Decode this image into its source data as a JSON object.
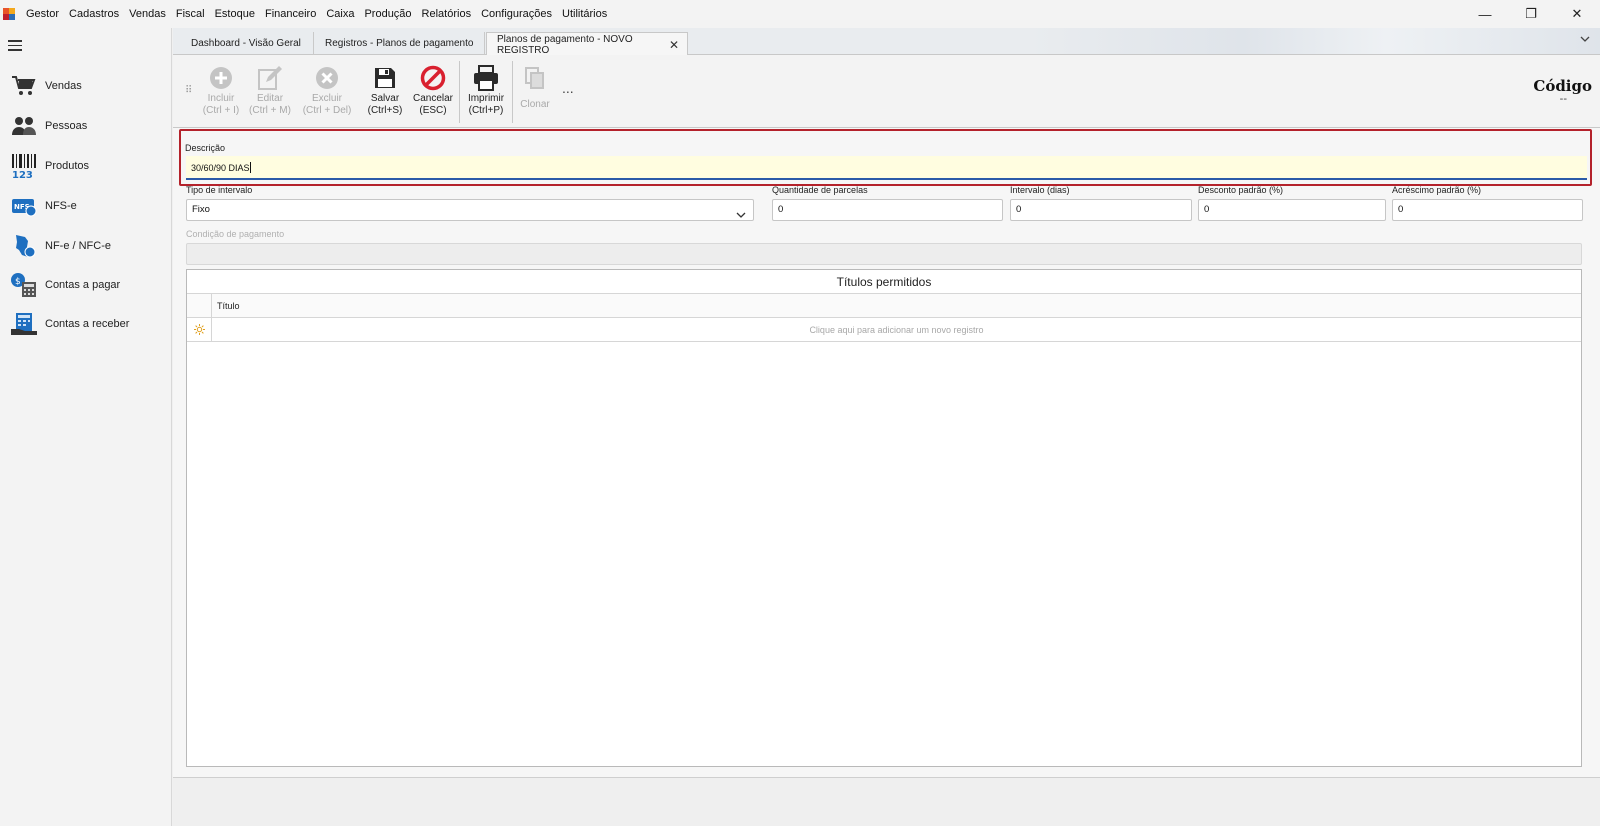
{
  "menu": {
    "items": [
      "Gestor",
      "Cadastros",
      "Vendas",
      "Fiscal",
      "Estoque",
      "Financeiro",
      "Caixa",
      "Produção",
      "Relatórios",
      "Configurações",
      "Utilitários"
    ]
  },
  "window": {
    "minimize": "—",
    "restore": "❐",
    "close": "✕"
  },
  "sidebar": {
    "items": [
      {
        "label": "Vendas",
        "icon": "shopping-cart-icon"
      },
      {
        "label": "Pessoas",
        "icon": "people-icon"
      },
      {
        "label": "Produtos",
        "icon": "barcode-icon"
      },
      {
        "label": "NFS-e",
        "icon": "nfse-icon"
      },
      {
        "label": "NF-e / NFC-e",
        "icon": "nfe-icon"
      },
      {
        "label": "Contas a pagar",
        "icon": "accounts-payable-icon"
      },
      {
        "label": "Contas a receber",
        "icon": "accounts-receivable-icon"
      }
    ]
  },
  "tabs": [
    {
      "label": "Dashboard - Visão Geral"
    },
    {
      "label": "Registros - Planos de pagamento"
    },
    {
      "label": "Planos de pagamento - NOVO REGISTRO",
      "close": "✕"
    }
  ],
  "toolbar": {
    "incluir": {
      "line1": "Incluir",
      "line2": "(Ctrl + I)"
    },
    "editar": {
      "line1": "Editar",
      "line2": "(Ctrl + M)"
    },
    "excluir": {
      "line1": "Excluir",
      "line2": "(Ctrl + Del)"
    },
    "salvar": {
      "line1": "Salvar",
      "line2": "(Ctrl+S)"
    },
    "cancelar": {
      "line1": "Cancelar",
      "line2": "(ESC)"
    },
    "imprimir": {
      "line1": "Imprimir",
      "line2": "(Ctrl+P)"
    },
    "clonar": {
      "line1": "Clonar"
    },
    "more": "..."
  },
  "codigo": {
    "label": "Código",
    "value": "--"
  },
  "form": {
    "descricao": {
      "label": "Descrição",
      "value": "30/60/90 DIAS"
    },
    "tipo_intervalo": {
      "label": "Tipo de intervalo",
      "value": "Fixo"
    },
    "quantidade_parcelas": {
      "label": "Quantidade de parcelas",
      "value": "0"
    },
    "intervalo_dias": {
      "label": "Intervalo (dias)",
      "value": "0"
    },
    "desconto_padrao": {
      "label": "Desconto padrão (%)",
      "value": "0"
    },
    "acrescimo_padrao": {
      "label": "Acréscimo padrão (%)",
      "value": "0"
    },
    "condicao_pagamento": {
      "label": "Condição de pagamento",
      "value": ""
    }
  },
  "grid": {
    "title": "Títulos permitidos",
    "columns": [
      "Título"
    ],
    "new_row_text": "Clique aqui para adicionar um novo registro"
  },
  "colors": {
    "highlight_border": "#b4222b",
    "input_focus_bg": "#fffde0",
    "input_focus_underline": "#2b5aa8",
    "cancel_red": "#d9202f"
  }
}
